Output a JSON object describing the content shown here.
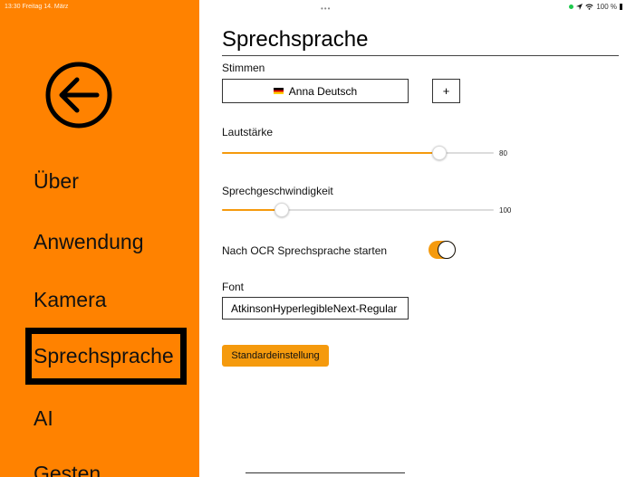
{
  "status": {
    "time_date": "13:30  Freitag 14. März",
    "dots": "•••",
    "battery": "100 %"
  },
  "sidebar": {
    "items": [
      {
        "label": "Über"
      },
      {
        "label": "Anwendung"
      },
      {
        "label": "Kamera"
      },
      {
        "label": "Sprechsprache",
        "selected": true
      },
      {
        "label": "AI"
      },
      {
        "label": "Gesten"
      }
    ],
    "background_color": "#ff8200"
  },
  "main": {
    "title": "Sprechsprache",
    "voices_label": "Stimmen",
    "voice_selected": "Anna Deutsch",
    "add_label": "+",
    "volume": {
      "label": "Lautstärke",
      "value": "80",
      "fraction": 0.8
    },
    "speed": {
      "label": "Sprechgeschwindigkeit",
      "value": "100",
      "fraction": 0.22
    },
    "ocr_toggle": {
      "label": "Nach OCR Sprechsprache starten",
      "on": true
    },
    "font_label": "Font",
    "font_value": "AtkinsonHyperlegibleNext-Regular",
    "default_button": "Standardeinstellung",
    "accent_color": "#f59a0d"
  }
}
